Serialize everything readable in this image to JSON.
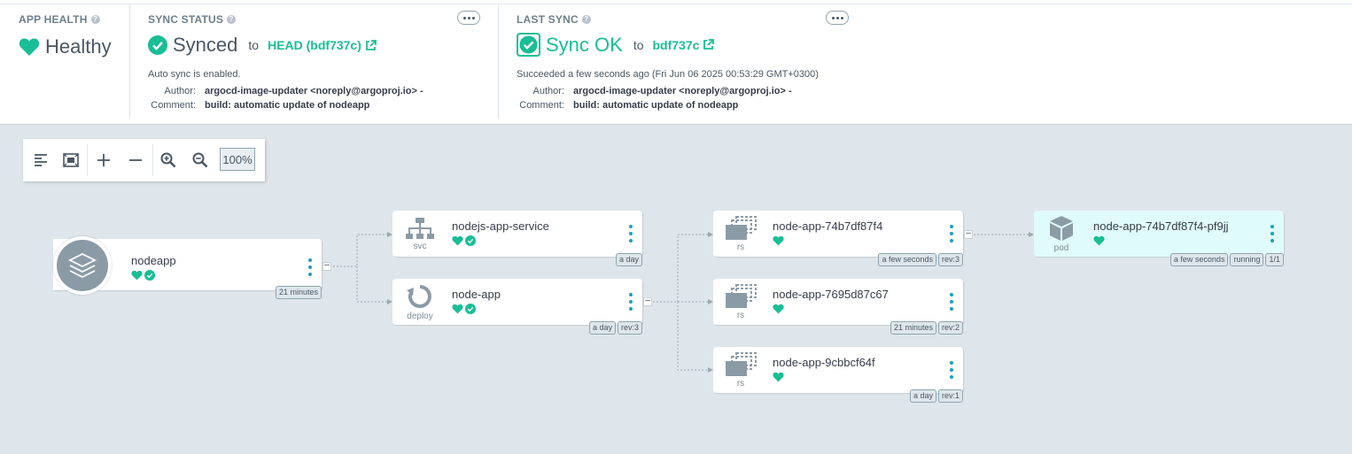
{
  "app_health": {
    "title": "APP HEALTH",
    "status": "Healthy"
  },
  "sync_status": {
    "title": "SYNC STATUS",
    "status": "Synced",
    "to_text": "to",
    "revision": "HEAD (bdf737c)",
    "note": "Auto sync is enabled.",
    "author_label": "Author:",
    "author": "argocd-image-updater <noreply@argoproj.io> -",
    "comment_label": "Comment:",
    "comment": "build: automatic update of nodeapp"
  },
  "last_sync": {
    "title": "LAST SYNC",
    "status": "Sync OK",
    "to_text": "to",
    "revision": "bdf737c",
    "note": "Succeeded a few seconds ago (Fri Jun 06 2025 00:53:29 GMT+0300)",
    "author_label": "Author:",
    "author": "argocd-image-updater <noreply@argoproj.io> -",
    "comment_label": "Comment:",
    "comment": "build: automatic update of nodeapp"
  },
  "toolbar": {
    "zoom": "100%"
  },
  "colors": {
    "healthy": "#18be94",
    "link": "#18a0c0",
    "pod_bg": "#e0fbfb"
  },
  "tree": {
    "app": {
      "name": "nodeapp",
      "age": "21 minutes",
      "collapse": "–"
    },
    "service": {
      "name": "nodejs-app-service",
      "kind": "svc",
      "age": "a day"
    },
    "deploy": {
      "name": "node-app",
      "kind": "deploy",
      "age": "a day",
      "rev": "rev:3",
      "collapse": "–"
    },
    "replicasets": [
      {
        "name": "node-app-74b7df87f4",
        "kind": "rs",
        "age": "a few seconds",
        "rev": "rev:3",
        "collapse": "–"
      },
      {
        "name": "node-app-7695d87c67",
        "kind": "rs",
        "age": "21 minutes",
        "rev": "rev:2"
      },
      {
        "name": "node-app-9cbbcf64f",
        "kind": "rs",
        "age": "a day",
        "rev": "rev:1"
      }
    ],
    "pod": {
      "name": "node-app-74b7df87f4-pf9jj",
      "kind": "pod",
      "age": "a few seconds",
      "state": "running",
      "ready": "1/1"
    }
  }
}
